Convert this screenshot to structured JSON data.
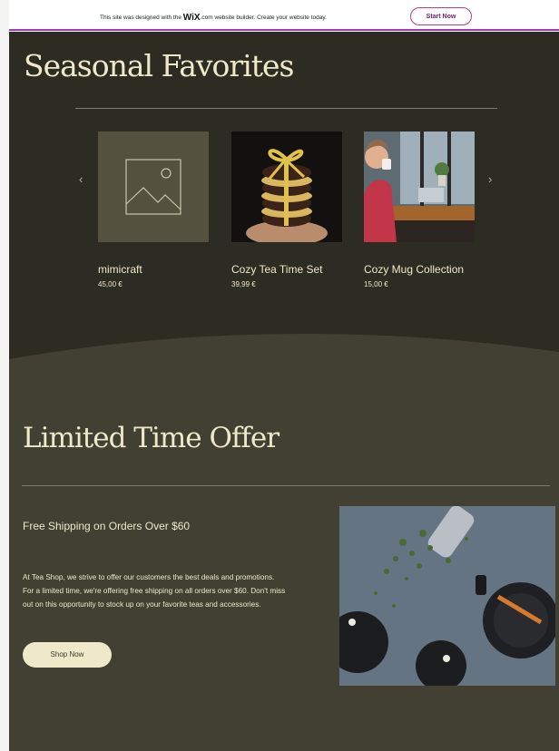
{
  "wix_banner": {
    "message_before": "This site was designed with the",
    "brand": "WiX",
    "brand_suffix": ".com",
    "message_after": "website builder. Create your website today.",
    "cta_label": "Start Now"
  },
  "seasonal": {
    "title": "Seasonal Favorites",
    "prev_arrow": "‹",
    "next_arrow": "›",
    "products": [
      {
        "name": "mimicraft",
        "price": "45,00 €",
        "image": "placeholder-image-icon"
      },
      {
        "name": "Cozy Tea Time Set",
        "price": "39,99 €",
        "image": "cookie-stack-photo"
      },
      {
        "name": "Cozy Mug Collection",
        "price": "15,00 €",
        "image": "woman-with-mug-photo"
      }
    ]
  },
  "offer": {
    "title": "Limited Time Offer",
    "subtitle": "Free Shipping on Orders Over $60",
    "body": "At Tea Shop, we strive to offer our customers the best deals and promotions. For a limited time, we're offering free shipping on all orders over $60. Don't miss out on this opportunity to stock up on your favorite teas and accessories.",
    "button_label": "Shop Now",
    "image": "tea-leaves-photo"
  },
  "colors": {
    "dark_section": "#2d2c23",
    "olive_section": "#414032",
    "cream_text": "#efe8c9",
    "wix_accent": "#a23ab2"
  }
}
